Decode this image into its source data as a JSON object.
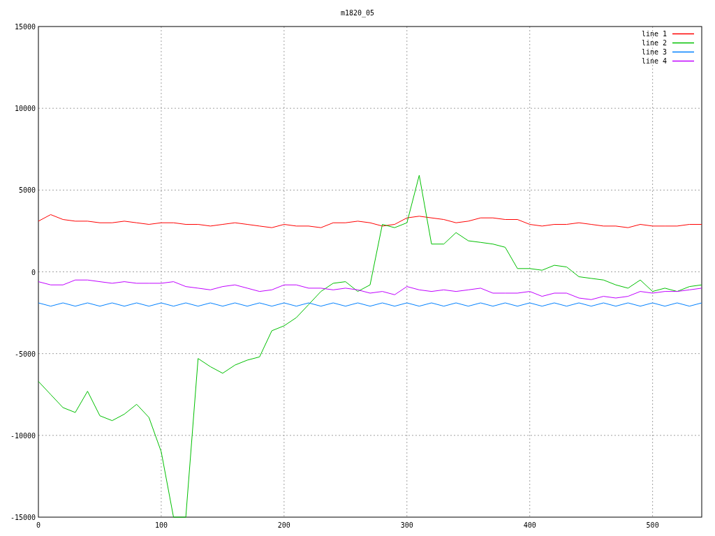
{
  "plot": {
    "chart_data": {
      "type": "line",
      "title": "m1820_05",
      "x": [
        0,
        10,
        20,
        30,
        40,
        50,
        60,
        70,
        80,
        90,
        100,
        110,
        120,
        130,
        140,
        150,
        160,
        170,
        180,
        190,
        200,
        210,
        220,
        230,
        240,
        250,
        260,
        270,
        280,
        290,
        300,
        310,
        320,
        330,
        340,
        350,
        360,
        370,
        380,
        390,
        400,
        410,
        420,
        430,
        440,
        450,
        460,
        470,
        480,
        490,
        500,
        510,
        520,
        530,
        540
      ],
      "grid": true,
      "legend": true,
      "xlim": [
        0,
        540
      ],
      "ylim": [
        -15000,
        15000
      ],
      "xticks": [
        0,
        100,
        200,
        300,
        400,
        500
      ],
      "yticks": [
        -15000,
        -10000,
        -5000,
        0,
        5000,
        10000,
        15000
      ],
      "series": [
        {
          "name": "line 1",
          "color": "#ff0000",
          "values": [
            3100,
            3500,
            3200,
            3100,
            3100,
            3000,
            3000,
            3100,
            3000,
            2900,
            3000,
            3000,
            2900,
            2900,
            2800,
            2900,
            3000,
            2900,
            2800,
            2700,
            2900,
            2800,
            2800,
            2700,
            3000,
            3000,
            3100,
            3000,
            2800,
            2900,
            3300,
            3400,
            3300,
            3200,
            3000,
            3100,
            3300,
            3300,
            3200,
            3200,
            2900,
            2800,
            2900,
            2900,
            3000,
            2900,
            2800,
            2800,
            2700,
            2900,
            2800,
            2800,
            2800,
            2900,
            2900
          ]
        },
        {
          "name": "line 2",
          "color": "#00c000",
          "values": [
            -6700,
            -7500,
            -8300,
            -8600,
            -7300,
            -8800,
            -9100,
            -8700,
            -8100,
            -8900,
            -11000,
            -15000,
            -15000,
            -5300,
            -5800,
            -6200,
            -5700,
            -5400,
            -5200,
            -3600,
            -3300,
            -2800,
            -2000,
            -1200,
            -700,
            -600,
            -1200,
            -800,
            2900,
            2700,
            3000,
            5900,
            1700,
            1700,
            2400,
            1900,
            1800,
            1700,
            1500,
            200,
            200,
            100,
            400,
            300,
            -300,
            -400,
            -500,
            -800,
            -1000,
            -500,
            -1200,
            -1000,
            -1200,
            -900,
            -800
          ]
        },
        {
          "name": "line 3",
          "color": "#0080ff",
          "values": [
            -1900,
            -2100,
            -1900,
            -2100,
            -1900,
            -2100,
            -1900,
            -2100,
            -1900,
            -2100,
            -1900,
            -2100,
            -1900,
            -2100,
            -1900,
            -2100,
            -1900,
            -2100,
            -1900,
            -2100,
            -1900,
            -2100,
            -1900,
            -2100,
            -1900,
            -2100,
            -1900,
            -2100,
            -1900,
            -2100,
            -1900,
            -2100,
            -1900,
            -2100,
            -1900,
            -2100,
            -1900,
            -2100,
            -1900,
            -2100,
            -1900,
            -2100,
            -1900,
            -2100,
            -1900,
            -2100,
            -1900,
            -2100,
            -1900,
            -2100,
            -1900,
            -2100,
            -1900,
            -2100,
            -1900
          ]
        },
        {
          "name": "line 4",
          "color": "#c000ff",
          "values": [
            -600,
            -800,
            -800,
            -500,
            -500,
            -600,
            -700,
            -600,
            -700,
            -700,
            -700,
            -600,
            -900,
            -1000,
            -1100,
            -900,
            -800,
            -1000,
            -1200,
            -1100,
            -800,
            -800,
            -1000,
            -1000,
            -1100,
            -1000,
            -1100,
            -1300,
            -1200,
            -1400,
            -900,
            -1100,
            -1200,
            -1100,
            -1200,
            -1100,
            -1000,
            -1300,
            -1300,
            -1300,
            -1200,
            -1500,
            -1300,
            -1300,
            -1600,
            -1700,
            -1500,
            -1600,
            -1500,
            -1200,
            -1300,
            -1200,
            -1200,
            -1100,
            -1000
          ]
        }
      ]
    }
  }
}
